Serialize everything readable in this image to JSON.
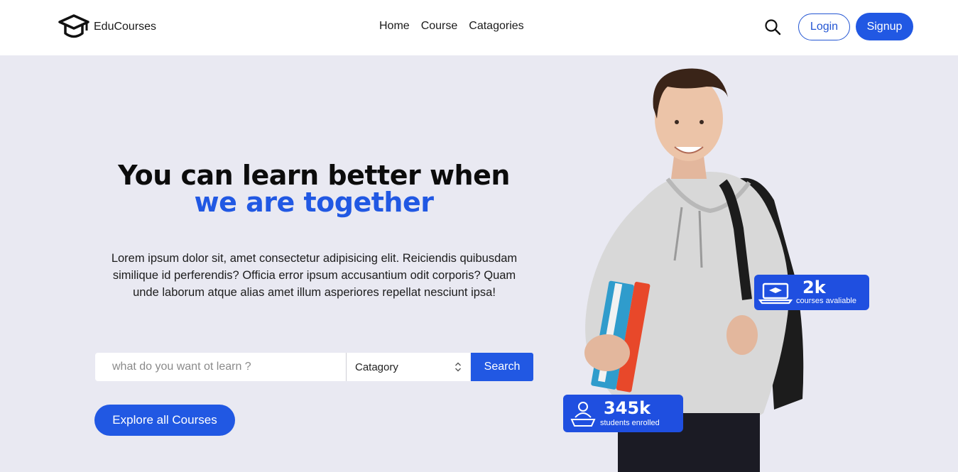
{
  "brand": {
    "name": "EduCourses",
    "logo_icon": "graduation-cap-icon"
  },
  "nav": {
    "links": [
      "Home",
      "Course",
      "Catagories"
    ]
  },
  "header_actions": {
    "search_icon": "search-icon",
    "login_label": "Login",
    "signup_label": "Signup"
  },
  "hero": {
    "headline_line1": "You can learn better when",
    "headline_line2": "we are together",
    "description": "Lorem ipsum dolor sit, amet consectetur adipisicing elit. Reiciendis quibusdam similique id perferendis? Officia error ipsum accusantium odit corporis? Quam unde laborum atque alias amet illum asperiores repellat nesciunt ipsa!",
    "search_placeholder": "what do you want ot learn ?",
    "category_selected": "Catagory",
    "search_button": "Search",
    "explore_button": "Explore all Courses"
  },
  "stats": {
    "courses": {
      "value": "2k",
      "label": "courses avaliable",
      "icon": "laptop-graduation-icon"
    },
    "students": {
      "value": "345k",
      "label": "students enrolled",
      "icon": "student-laptop-icon"
    }
  },
  "colors": {
    "accent": "#2158e3",
    "background": "#e9e9f2",
    "navbar": "#ffffff"
  }
}
